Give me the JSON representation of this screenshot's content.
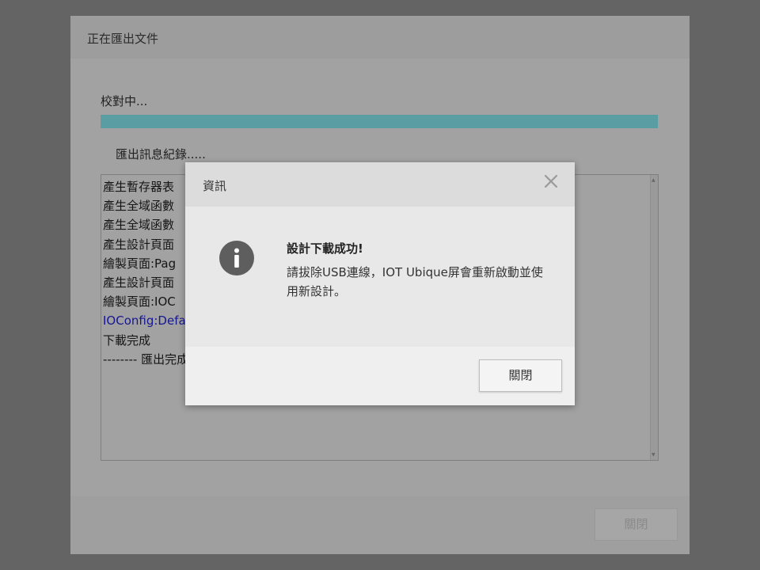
{
  "window": {
    "title": "正在匯出文件",
    "status": "校對中...",
    "progress": 1.0,
    "log_label": "匯出訊息紀錄.....",
    "log_lines": [
      {
        "text": "產生暫存器表",
        "link": false
      },
      {
        "text": "產生全域函數",
        "link": false
      },
      {
        "text": "產生全域函數",
        "link": false
      },
      {
        "text": "產生設計頁面",
        "link": false
      },
      {
        "text": "繪製頁面:Pag",
        "link": false
      },
      {
        "text": "產生設計頁面",
        "link": false
      },
      {
        "text": "繪製頁面:IOC",
        "link": false
      },
      {
        "text": "IOConfig:Defa",
        "link": true
      },
      {
        "text": "下載完成",
        "link": false
      },
      {
        "text": "-------- 匯出完成",
        "link": false
      }
    ],
    "close_label": "關閉"
  },
  "dialog": {
    "title": "資訊",
    "message_title": "設計下載成功!",
    "message": "請拔除USB連線，IOT Ubique屏會重新啟動並使用新設計。",
    "close_label": "關閉",
    "icon": "info-icon"
  },
  "colors": {
    "progress": "#5a9ea4",
    "link": "#17178f",
    "overlay": "#646464"
  }
}
